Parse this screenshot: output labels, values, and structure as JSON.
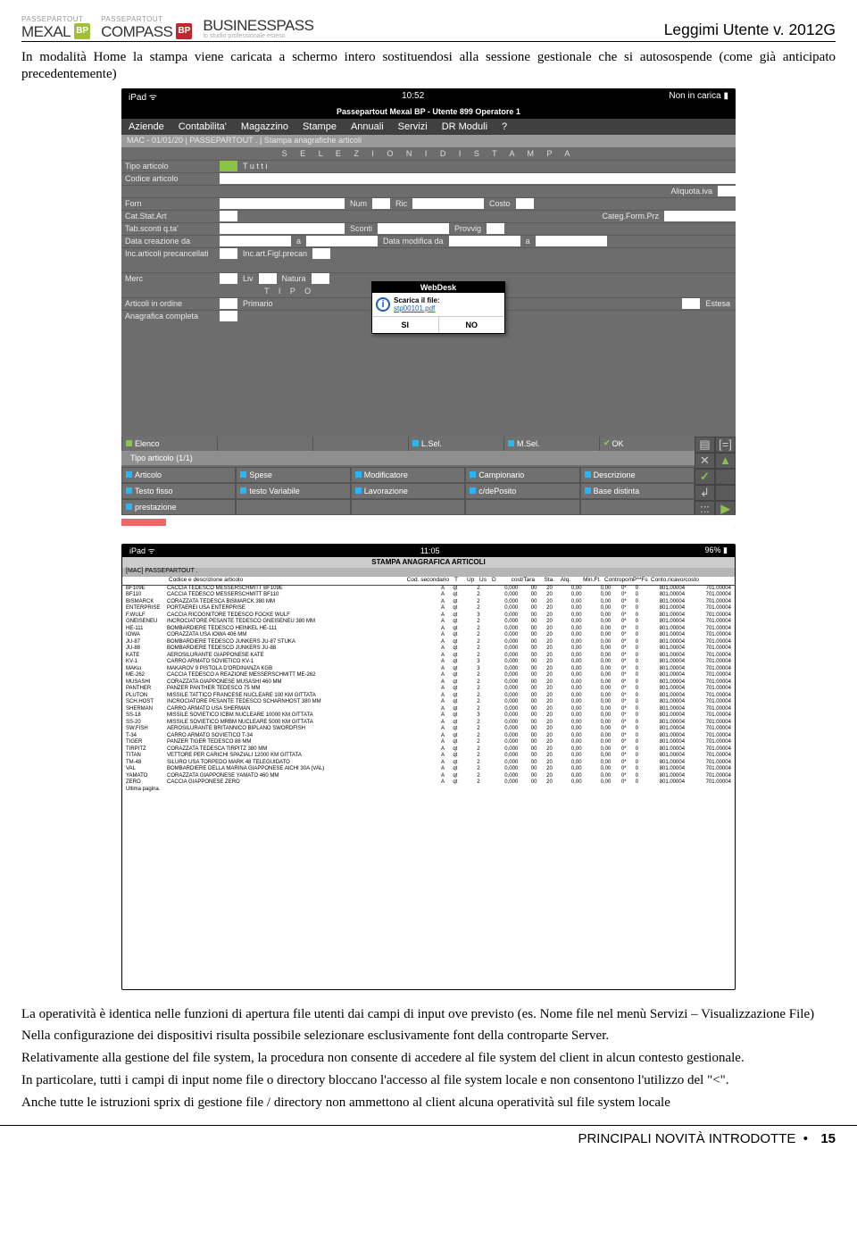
{
  "header": {
    "logos": [
      {
        "top": "PASSEPARTOUT",
        "name": "MEXAL",
        "bp": "BP",
        "bpColor": "green",
        "sub": ""
      },
      {
        "top": "PASSEPARTOUT",
        "name": "COMPASS",
        "bp": "BP",
        "bpColor": "red",
        "sub": ""
      },
      {
        "top": "",
        "name": "BUSINESSPASS",
        "bp": "",
        "bpColor": "",
        "sub": "lo studio professionale esteso"
      }
    ],
    "right": "Leggimi Utente v. 2012G"
  },
  "intro": "In modalità Home la stampa viene caricata a schermo intero sostituendosi alla sessione gestionale che si autosospende (come già anticipato precedentemente)",
  "shot1": {
    "status": {
      "left": "iPad ᯤ",
      "center": "10:52",
      "right": "Non in carica ▮"
    },
    "title": "Passepartout Mexal BP - Utente 899 Operatore 1",
    "menu": [
      "Aziende",
      "Contabilita'",
      "Magazzino",
      "Stampe",
      "Annuali",
      "Servizi",
      "DR Moduli",
      "?"
    ],
    "crumb": "MAC - 01/01/20 | PASSEPARTOUT . | Stampa anagrafiche articoli",
    "sect1": "S E L E Z I O N I     D I     S T A M P A",
    "form": {
      "r1": {
        "l": "Tipo articolo",
        "v": "T u t t i"
      },
      "r2": {
        "l": "Codice articolo"
      },
      "r3": {
        "l": "Forn",
        "l2": "Num",
        "l3": "Ric",
        "l4": "Aliquota.iva",
        "l5": "Costo"
      },
      "r4": {
        "l": "Cat.Stat.Art",
        "l2": "Categ.Form.Prz"
      },
      "r5": {
        "l": "Tab.sconti q.ta'",
        "l2": "Sconti",
        "l3": "Provvig"
      },
      "r6": {
        "l": "Data creazione da",
        "l2": "a",
        "l3": "Data modifica da",
        "l4": "a"
      },
      "r7": {
        "l": "Inc.articoli precancellati",
        "l2": "Inc.art.Figl.precan"
      },
      "r8": {
        "l": "Merc",
        "l2": "Liv",
        "l3": "Natura"
      },
      "sect2": "T I P O",
      "r9": {
        "l": "Articoli in ordine",
        "l2": "Primario",
        "l3": "Estesa"
      },
      "r10": {
        "l": "Anagrafica completa"
      }
    },
    "modal": {
      "hd": "WebDesk",
      "text": "Scarica il file:",
      "link": "stp00101.pdf",
      "yes": "SI",
      "no": "NO"
    },
    "footerBar": [
      {
        "c": "green",
        "t": "Elenco"
      },
      {
        "c": "",
        "t": ""
      },
      {
        "c": "",
        "t": ""
      },
      {
        "c": "cyan",
        "t": "L.Sel."
      },
      {
        "c": "cyan",
        "t": "M.Sel."
      },
      {
        "c": "tick",
        "t": "OK"
      }
    ],
    "midbar": "Tipo articolo (1/1)",
    "grid": [
      {
        "c": "cyan",
        "t": "Articolo"
      },
      {
        "c": "cyan",
        "t": "Spese"
      },
      {
        "c": "cyan",
        "t": "Modificatore"
      },
      {
        "c": "cyan",
        "t": "Campionario"
      },
      {
        "c": "cyan",
        "t": "Descrizione"
      },
      {
        "c": "cyan",
        "t": "Testo fisso"
      },
      {
        "c": "cyan",
        "t": "testo Variabile"
      },
      {
        "c": "cyan",
        "t": "Lavorazione"
      },
      {
        "c": "cyan",
        "t": "c/dePosito"
      },
      {
        "c": "cyan",
        "t": "Base distinta"
      },
      {
        "c": "cyan",
        "t": "prestazione"
      },
      {
        "c": "",
        "t": ""
      },
      {
        "c": "",
        "t": ""
      },
      {
        "c": "",
        "t": ""
      },
      {
        "c": "",
        "t": ""
      }
    ],
    "right": [
      "▤",
      "[=]",
      "✕",
      "▲",
      "✓",
      "",
      "↲",
      "",
      ":::",
      "▶"
    ]
  },
  "shot2": {
    "status": {
      "left": "iPad ᯤ",
      "center": "11:05",
      "right": "96% ▮"
    },
    "title": "STAMPA ANAGRAFICA ARTICOLI",
    "sub": "[MAC] PASSEPARTOUT .",
    "head": [
      "Codice e descrizione articolo",
      "Cod. secondario",
      "T",
      "Up",
      "Us",
      "D",
      "cost/Tara",
      "Sta.",
      "Alq.",
      "Min.Ft.",
      "Contropo/ni",
      "P**Fs",
      "Conto.ricavo/costo"
    ],
    "rows": [
      [
        "BF109E",
        "CACCIA TEDESCO MESSERSCHMITT BF109E",
        "",
        "A",
        "qt",
        "",
        "2",
        "",
        "0,000",
        "00",
        "20",
        "0,00",
        "0,00",
        "0*",
        "0",
        "801.00004",
        "701.00004"
      ],
      [
        "BF110",
        "CACCIA TEDESCO MESSERSCHMITT BF110",
        "",
        "A",
        "qt",
        "",
        "2",
        "",
        "0,000",
        "00",
        "20",
        "0,00",
        "0,00",
        "0*",
        "0",
        "801.00004",
        "701.00004"
      ],
      [
        "BISMARCK",
        "CORAZZATA TEDESCA BISMARCK 380 MM",
        "",
        "A",
        "qt",
        "",
        "2",
        "",
        "0,000",
        "00",
        "20",
        "0,00",
        "0,00",
        "0*",
        "0",
        "801.00004",
        "701.00004"
      ],
      [
        "ENTERPRISE",
        "PORTAEREI USA ENTERPRISE",
        "",
        "A",
        "qt",
        "",
        "2",
        "",
        "0,000",
        "00",
        "20",
        "0,00",
        "0,00",
        "0*",
        "0",
        "801.00004",
        "701.00004"
      ],
      [
        "F.WULF",
        "CACCIA RICOGNITORE TEDESCO FOCKE WULF",
        "",
        "A",
        "qt",
        "",
        "3",
        "",
        "0,000",
        "00",
        "20",
        "0,00",
        "0,00",
        "0*",
        "0",
        "801.00004",
        "701.00004"
      ],
      [
        "GNEISENEU",
        "INCROCIATORE PESANTE TEDESCO GNEISENEU 380 MM",
        "",
        "A",
        "qt",
        "",
        "2",
        "",
        "0,000",
        "00",
        "20",
        "0,00",
        "0,00",
        "0*",
        "0",
        "801.00004",
        "701.00004"
      ],
      [
        "HE-111",
        "BOMBARDIERE TEDESCO HEINKEL HE-111",
        "",
        "A",
        "qt",
        "",
        "2",
        "",
        "0,000",
        "00",
        "20",
        "0,00",
        "0,00",
        "0*",
        "0",
        "801.00004",
        "701.00004"
      ],
      [
        "IOWA",
        "CORAZZATA USA IOWA 406 MM",
        "",
        "A",
        "qt",
        "",
        "2",
        "",
        "0,000",
        "00",
        "20",
        "0,00",
        "0,00",
        "0*",
        "0",
        "801.00004",
        "701.00004"
      ],
      [
        "JU-87",
        "BOMBARDIERE TEDESCO JUNKERS JU-87 STUKA",
        "",
        "A",
        "qt",
        "",
        "2",
        "",
        "0,000",
        "00",
        "20",
        "0,00",
        "0,00",
        "0*",
        "0",
        "801.00004",
        "701.00004"
      ],
      [
        "JU-88",
        "BOMBARDIERE TEDESCO JUNKERS JU-88",
        "",
        "A",
        "qt",
        "",
        "2",
        "",
        "0,000",
        "00",
        "20",
        "0,00",
        "0,00",
        "0*",
        "0",
        "801.00004",
        "701.00004"
      ],
      [
        "KATE",
        "AEROSILURANTE GIAPPONESE KATE",
        "",
        "A",
        "qt",
        "",
        "2",
        "",
        "0,000",
        "00",
        "20",
        "0,00",
        "0,00",
        "0*",
        "0",
        "801.00004",
        "701.00004"
      ],
      [
        "KV-1",
        "CARRO ARMATO SOVIETICO KV-1",
        "",
        "A",
        "qt",
        "",
        "3",
        "",
        "0,000",
        "00",
        "20",
        "0,00",
        "0,00",
        "0*",
        "0",
        "801.00004",
        "701.00004"
      ],
      [
        "MAKει",
        "MAKAROV 9 PISTOLA D'ORDINANZA KGB",
        "",
        "A",
        "qt",
        "",
        "3",
        "",
        "0,000",
        "00",
        "20",
        "0,00",
        "0,00",
        "0*",
        "0",
        "801.00004",
        "701.00004"
      ],
      [
        "ME-262",
        "CACCIA TEDESCO A REAZIONE MESSERSCHMITT ME-262",
        "",
        "A",
        "qt",
        "",
        "2",
        "",
        "0,000",
        "00",
        "20",
        "0,00",
        "0,00",
        "0*",
        "0",
        "801.00004",
        "701.00004"
      ],
      [
        "MUSASHI",
        "CORAZZATA GIAPPONESE MUSASHI 460 MM",
        "",
        "A",
        "qt",
        "",
        "2",
        "",
        "0,000",
        "00",
        "20",
        "0,00",
        "0,00",
        "0*",
        "0",
        "801.00004",
        "701.00004"
      ],
      [
        "PANTHER",
        "PANZER PANTHER TEDESCO 75 MM",
        "",
        "A",
        "qt",
        "",
        "2",
        "",
        "0,000",
        "00",
        "20",
        "0,00",
        "0,00",
        "0*",
        "0",
        "801.00004",
        "701.00004"
      ],
      [
        "PLUTON",
        "MISSILE TATTICO FRANCESE NUCLEARE 100 KM GITTATA",
        "",
        "A",
        "qt",
        "",
        "2",
        "",
        "0,000",
        "00",
        "20",
        "0,00",
        "0,00",
        "0*",
        "0",
        "801.00004",
        "701.00004"
      ],
      [
        "SCH.HOST",
        "INCROCIATORE PESANTE TEDESCO SCHARNHOST 380 MM",
        "",
        "A",
        "qt",
        "",
        "2",
        "",
        "0,000",
        "00",
        "20",
        "0,00",
        "0,00",
        "0*",
        "0",
        "801.00004",
        "701.00004"
      ],
      [
        "SHERMAN",
        "CARRO ARMATO USA SHERMAN",
        "",
        "A",
        "qt",
        "",
        "2",
        "",
        "0,000",
        "00",
        "20",
        "0,00",
        "0,00",
        "0*",
        "0",
        "801.00004",
        "701.00004"
      ],
      [
        "SS-18",
        "MISSILE SOVIETICO ICBM NUCLEARE 10000 KM GITTATA",
        "",
        "A",
        "qt",
        "",
        "3",
        "",
        "0,000",
        "00",
        "20",
        "0,00",
        "0,00",
        "0*",
        "0",
        "801.00004",
        "701.00004"
      ],
      [
        "SS-20",
        "MISSILE SOVIETICO MRBM NUCLEARE 5000 KM GITTATA",
        "",
        "A",
        "qt",
        "",
        "2",
        "",
        "0,000",
        "00",
        "20",
        "0,00",
        "0,00",
        "0*",
        "0",
        "801.00004",
        "701.00004"
      ],
      [
        "SW.FISH",
        "AEROSILURANTE BRITANNICO BIPLANO SWORDFISH",
        "",
        "A",
        "qt",
        "",
        "2",
        "",
        "0,000",
        "00",
        "20",
        "0,00",
        "0,00",
        "0*",
        "0",
        "801.00004",
        "701.00004"
      ],
      [
        "T-34",
        "CARRO ARMATO SOVIETICO T-34",
        "",
        "A",
        "qt",
        "",
        "2",
        "",
        "0,000",
        "00",
        "20",
        "0,00",
        "0,00",
        "0*",
        "0",
        "801.00004",
        "701.00004"
      ],
      [
        "TIGER",
        "PANZER TIGER TEDESCO 88 MM",
        "",
        "A",
        "qt",
        "",
        "2",
        "",
        "0,000",
        "00",
        "20",
        "0,00",
        "0,00",
        "0*",
        "0",
        "801.00004",
        "701.00004"
      ],
      [
        "TIRPITZ",
        "CORAZZATA TEDESCA TIRPITZ 380 MM",
        "",
        "A",
        "qt",
        "",
        "2",
        "",
        "0,000",
        "00",
        "20",
        "0,00",
        "0,00",
        "0*",
        "0",
        "801.00004",
        "701.00004"
      ],
      [
        "TITAN",
        "VETTORE PER CARICHI SPAZIALI 12000 KM GITTATA",
        "",
        "A",
        "qt",
        "",
        "2",
        "",
        "0,000",
        "00",
        "20",
        "0,00",
        "0,00",
        "0*",
        "0",
        "801.00004",
        "701.00004"
      ],
      [
        "TM-48",
        "SILURO USA TORPEDO MARK 48 TELEGUIDATO",
        "",
        "A",
        "qt",
        "",
        "2",
        "",
        "0,000",
        "00",
        "20",
        "0,00",
        "0,00",
        "0*",
        "0",
        "801.00004",
        "701.00004"
      ],
      [
        "VAL",
        "BOMBARDIERE DELLA MARINA GIAPPONESE AICHI 30A (VAL)",
        "",
        "A",
        "qt",
        "",
        "2",
        "",
        "0,000",
        "00",
        "20",
        "0,00",
        "0,00",
        "0*",
        "0",
        "801.00004",
        "701.00004"
      ],
      [
        "YAMATO",
        "CORAZZATA GIAPPONESE YAMATO 460 MM",
        "",
        "A",
        "qt",
        "",
        "2",
        "",
        "0,000",
        "00",
        "20",
        "0,00",
        "0,00",
        "0*",
        "0",
        "801.00004",
        "701.00004"
      ],
      [
        "ZERO",
        "CACCIA GIAPPONESE ZERO",
        "",
        "A",
        "qt",
        "",
        "2",
        "",
        "0,000",
        "00",
        "20",
        "0,00",
        "0,00",
        "0*",
        "0",
        "801.00004",
        "701.00004"
      ]
    ],
    "last": "Ultima pagina."
  },
  "p1": "La operatività è identica nelle funzioni di apertura file utenti dai campi di input ove previsto (es. Nome file nel menù Servizi – Visualizzazione File)",
  "p2": "Nella configurazione dei dispositivi risulta possibile selezionare esclusivamente font della controparte Server.",
  "p3": "Relativamente alla gestione del file system, la procedura non consente di accedere al file system del client in alcun contesto gestionale.",
  "p4": "In particolare, tutti i campi di input nome file o directory bloccano l'accesso al file system locale e non consentono l'utilizzo del \"<\".",
  "p5": "Anche tutte le istruzioni sprix di gestione file / directory non ammettono al client alcuna operatività sul file system locale",
  "footer": {
    "label": "PRINCIPALI NOVITÀ INTRODOTTE",
    "bullet": "•",
    "page": "15"
  }
}
